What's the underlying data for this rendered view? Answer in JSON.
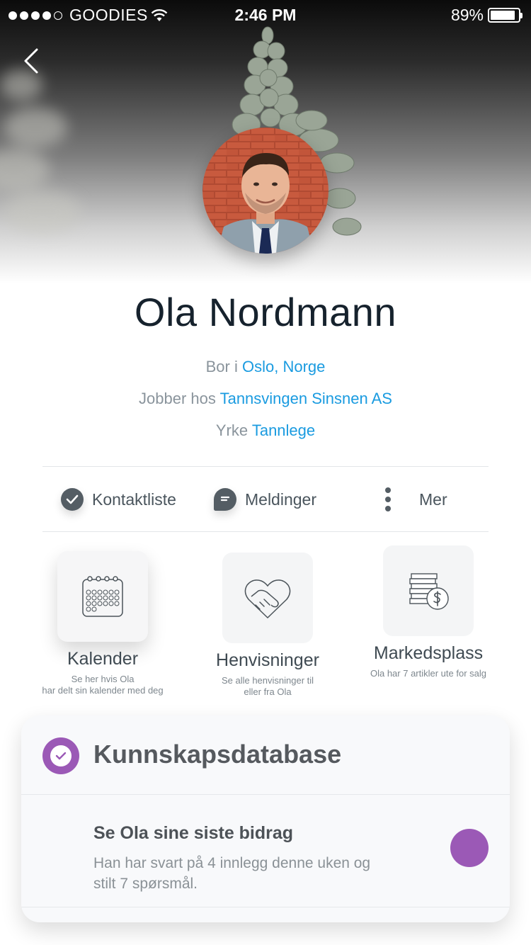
{
  "status_bar": {
    "carrier": "GOODIES",
    "time": "2:46 PM",
    "battery": "89%",
    "battery_level": 0.89,
    "signal_bars": 4
  },
  "header": {
    "back_icon": "chevron-left-icon"
  },
  "profile": {
    "name": "Ola Nordmann",
    "lives_prefix": "Bor i",
    "lives_value": "Oslo, Norge",
    "works_prefix": "Jobber hos",
    "works_value": "Tannsvingen Sinsnen AS",
    "job_prefix": "Yrke",
    "job_value": "Tannlege"
  },
  "actions": [
    {
      "label": "Kontaktliste",
      "icon": "check-circle-icon"
    },
    {
      "label": "Meldinger",
      "icon": "chat-bubble-icon"
    },
    {
      "label": "Mer",
      "icon": "more-vertical-icon"
    }
  ],
  "tiles": [
    {
      "title": "Kalender",
      "subtitle_1": "Se her hvis Ola",
      "subtitle_2": "har delt sin kalender med deg",
      "icon": "calendar-icon"
    },
    {
      "title": "Henvisninger",
      "subtitle_1": "Se alle henvisninger til",
      "subtitle_2": "eller fra Ola",
      "icon": "handshake-icon"
    },
    {
      "title": "Markedsplass",
      "subtitle_1": "Ola har 7 artikler ute for salg",
      "subtitle_2": "",
      "icon": "money-stack-icon"
    }
  ],
  "knowledge": {
    "title": "Kunnskapsdatabase",
    "row_title": "Se Ola sine siste bidrag",
    "row_subtitle": "Han har svart på 4 innlegg denne uken og stilt 7 spørsmål."
  },
  "colors": {
    "accent_blue": "#1a9be0",
    "accent_purple": "#9b59b6",
    "text_dark": "#16222d"
  }
}
